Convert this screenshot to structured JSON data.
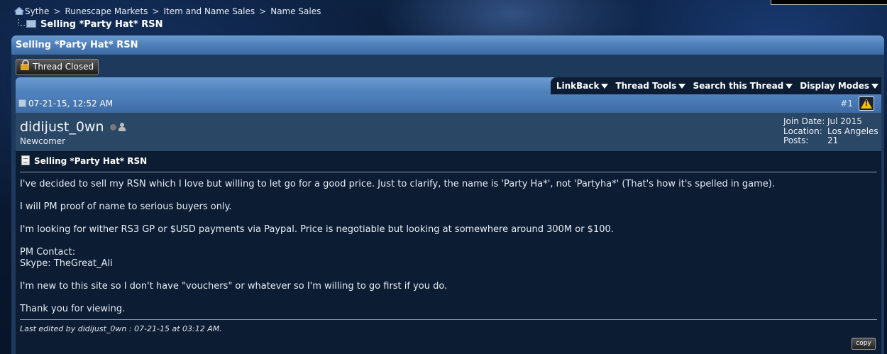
{
  "breadcrumb": {
    "items": [
      "Sythe",
      "Runescape Markets",
      "Item and Name Sales",
      "Name Sales"
    ],
    "separator": ">",
    "current": "Selling *Party Hat* RSN"
  },
  "thread": {
    "title": "Selling *Party Hat* RSN",
    "closed_label": "Thread Closed",
    "tools": [
      "LinkBack",
      "Thread Tools",
      "Search this Thread",
      "Display Modes"
    ]
  },
  "post": {
    "date": "07-21-15, 12:52 AM",
    "number": "#1",
    "user": {
      "name": "didijust_0wn",
      "title": "Newcomer",
      "join_date_label": "Join Date:",
      "join_date": "Jul 2015",
      "location_label": "Location:",
      "location": "Los Angeles",
      "posts_label": "Posts:",
      "posts": "21"
    },
    "title": "Selling *Party Hat* RSN",
    "body": [
      "I've decided to sell my RSN which I love but willing to let go for a good price. Just to clarify, the name is 'Party Ha*', not 'Partyha*' (That's how it's spelled in game).",
      "I will PM proof of name to serious buyers only.",
      "I'm looking for wither RS3 GP or $USD payments via Paypal. Price is negotiable but looking at somewhere around 300M or $100.",
      "PM Contact:",
      "Skype: TheGreat_Ali",
      "I'm new to this site so I don't have \"vouchers\" or whatever so I'm willing to go first if you do.",
      "Thank you for viewing."
    ],
    "edited": "Last edited by didijust_0wn : 07-21-15 at 03:12 AM.",
    "copy_label": "copy"
  },
  "colors": {
    "header_blue": "#4c7cb6",
    "post_bg": "#0c1c33",
    "user_bar": "#2b4766",
    "warning_yellow": "#f2c200"
  },
  "icons": [
    "home-icon",
    "folder-icon",
    "lock-icon",
    "dropdown-arrow-icon",
    "post-icon",
    "report-warning-icon",
    "offline-status-icon",
    "user-profile-icon",
    "document-icon"
  ]
}
